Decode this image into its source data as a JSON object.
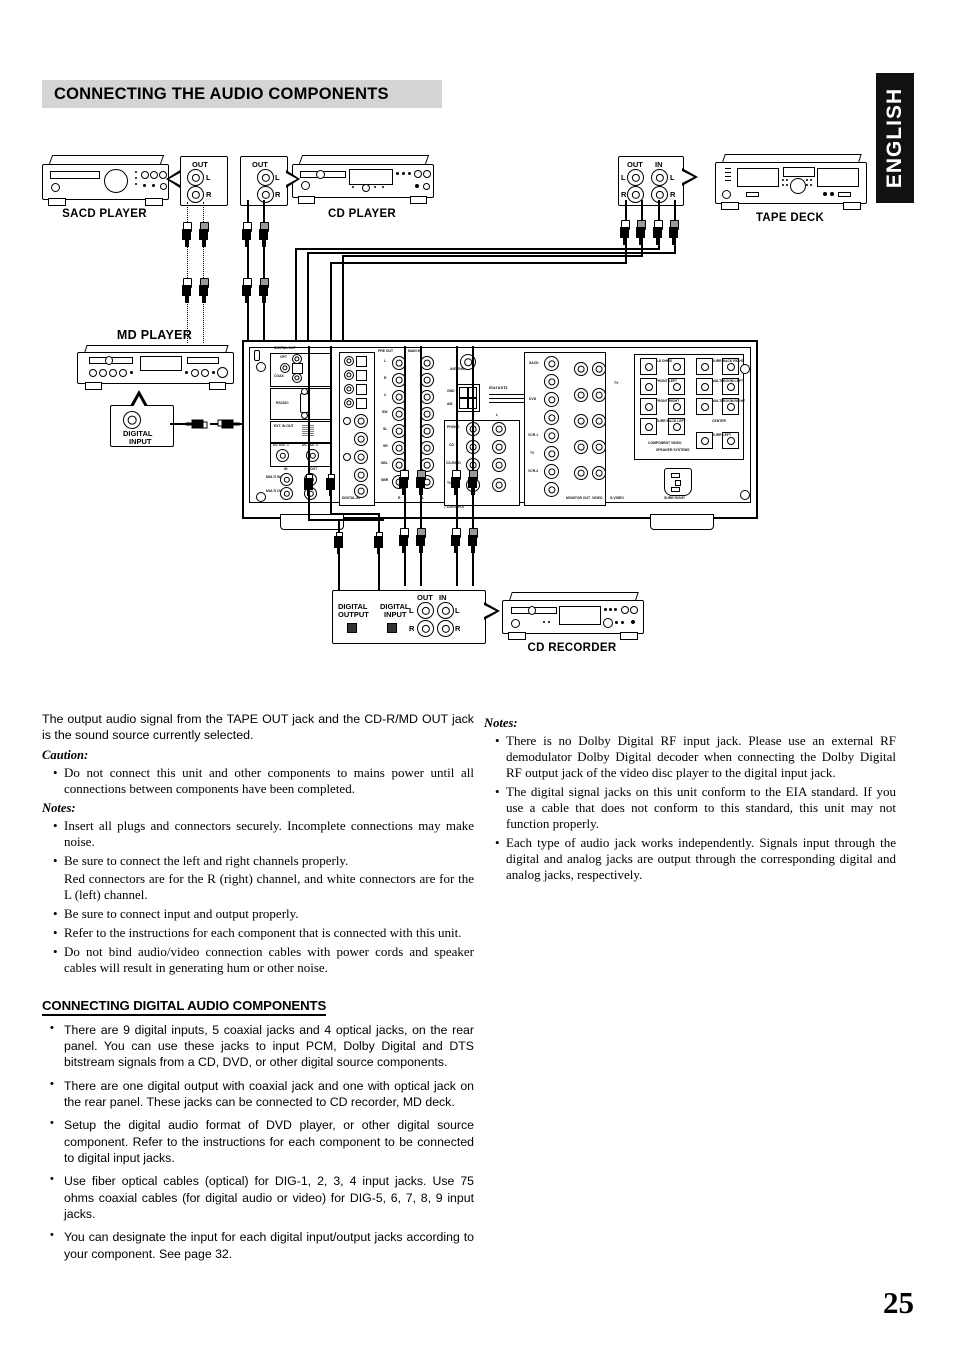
{
  "header": {
    "title": "CONNECTING THE AUDIO COMPONENTS"
  },
  "sidebar_tab": {
    "label": "ENGLISH"
  },
  "page_number": "25",
  "diagram": {
    "devices": [
      {
        "name": "sacd-player",
        "label": "SACD PLAYER"
      },
      {
        "name": "cd-player",
        "label": "CD PLAYER"
      },
      {
        "name": "tape-deck",
        "label": "TAPE DECK"
      },
      {
        "name": "md-player",
        "label": "MD PLAYER"
      },
      {
        "name": "cd-recorder",
        "label": "CD RECORDER"
      }
    ],
    "callouts": {
      "sacd_out": "OUT",
      "cd_out": "OUT",
      "tape_out": "OUT",
      "tape_in": "IN",
      "md_digital_input": "DIGITAL\nINPUT",
      "md_digital_input_line1": "DIGITAL",
      "md_digital_input_line2": "INPUT",
      "rec_digital_output_line1": "DIGITAL",
      "rec_digital_output_line2": "OUTPUT",
      "rec_digital_input_line1": "DIGITAL",
      "rec_digital_input_line2": "INPUT",
      "rec_out": "OUT",
      "rec_in": "IN",
      "channel_left": "L",
      "channel_right": "R"
    },
    "receiver": {
      "labels": [
        "DIGITAL-OUT",
        "OPT",
        "COAX",
        "RS232C",
        "EXT. IN OUT",
        "DC OUT 1",
        "DC OUT 2",
        "IN",
        "OUT",
        "MULTI IN",
        "MULTI OUT",
        "REMOTE CONTROL",
        "DIGITAL-IN",
        "PRE OUT",
        "MAIN IN",
        "ANTENNA",
        "GND",
        "AM",
        "L",
        "R",
        "C",
        "SW",
        "SL",
        "SR",
        "SBL",
        "SBR",
        "PHONO",
        "CD",
        "CD-R/MD",
        "TUNER",
        "TAPE",
        "7.1CH INPUT",
        "SACD",
        "DVD",
        "VCR-1",
        "VCR-2",
        "TV",
        "MONITOR OUT",
        "VIDEO",
        "S-VIDEO",
        "COMPONENT VIDEO",
        "SPEAKER SYSTEMS",
        "6-8 OHMS",
        "FRONT LEFT",
        "FRONT RIGHT",
        "SURR BACK LEFT",
        "SURR BACK RIGHT",
        "MULTI ROOM LEFT",
        "MULTI ROOM RIGHT",
        "CENTER",
        "SURR LEFT",
        "SURR RIGHT",
        "AC IN"
      ]
    }
  },
  "body": {
    "intro": "The output audio signal from the TAPE OUT jack and the CD-R/MD OUT jack is the sound source currently selected.",
    "caution_heading": "Caution:",
    "caution_items": [
      "Do not connect this unit and other components to mains power until all connections between components have been completed."
    ],
    "notes_heading": "Notes:",
    "notes_items": [
      "Insert all plugs and connectors securely.  Incomplete connections may make noise.",
      "Be sure to connect the left and right channels properly.",
      "Be sure to connect input and output properly.",
      "Refer to the instructions for each component that is connected with this unit.",
      "Do not bind audio/video connection cables with power cords and speaker cables will result in generating hum or other noise."
    ],
    "notes_item2_sub": "Red connectors are for the R (right) channel, and white connectors are for the L (left) channel.",
    "digital_heading": "CONNECTING DIGITAL AUDIO COMPONENTS",
    "digital_items": [
      "There are 9 digital inputs, 5 coaxial jacks and 4 optical jacks, on the rear panel. You can use these jacks to input PCM, Dolby Digital and DTS bitstream signals from a CD, DVD, or other digital source components.",
      "There are one digital output with coaxial jack and one with optical jack on the rear panel. These jacks can be connected to CD recorder, MD deck.",
      "Setup the digital audio format of DVD player, or other digital source component. Refer to the instructions for each component to be connected to digital input jacks.",
      "Use fiber optical cables (optical) for DIG-1, 2, 3, 4 input jacks.  Use 75 ohms coaxial cables (for digital audio or video) for DIG-5, 6, 7, 8, 9 input jacks.",
      "You can designate the input for each digital input/output jacks according to your component.  See page 32."
    ],
    "right_notes_heading": "Notes:",
    "right_notes_items": [
      "There is no Dolby Digital RF input jack. Please use an external RF demodulator Dolby Digital decoder when connecting the Dolby Digital RF output jack of the video disc player to the digital input jack.",
      "The digital signal jacks on this unit conform to the EIA standard.  If you use a cable that does not conform to this standard, this unit may not function properly.",
      "Each type of audio jack works independently. Signals input through the digital and analog jacks are output through the corresponding digital and analog jacks, respectively."
    ]
  },
  "colors": {
    "header_band": "#d4d4d4",
    "tab_bg": "#111111",
    "ink": "#000000"
  }
}
